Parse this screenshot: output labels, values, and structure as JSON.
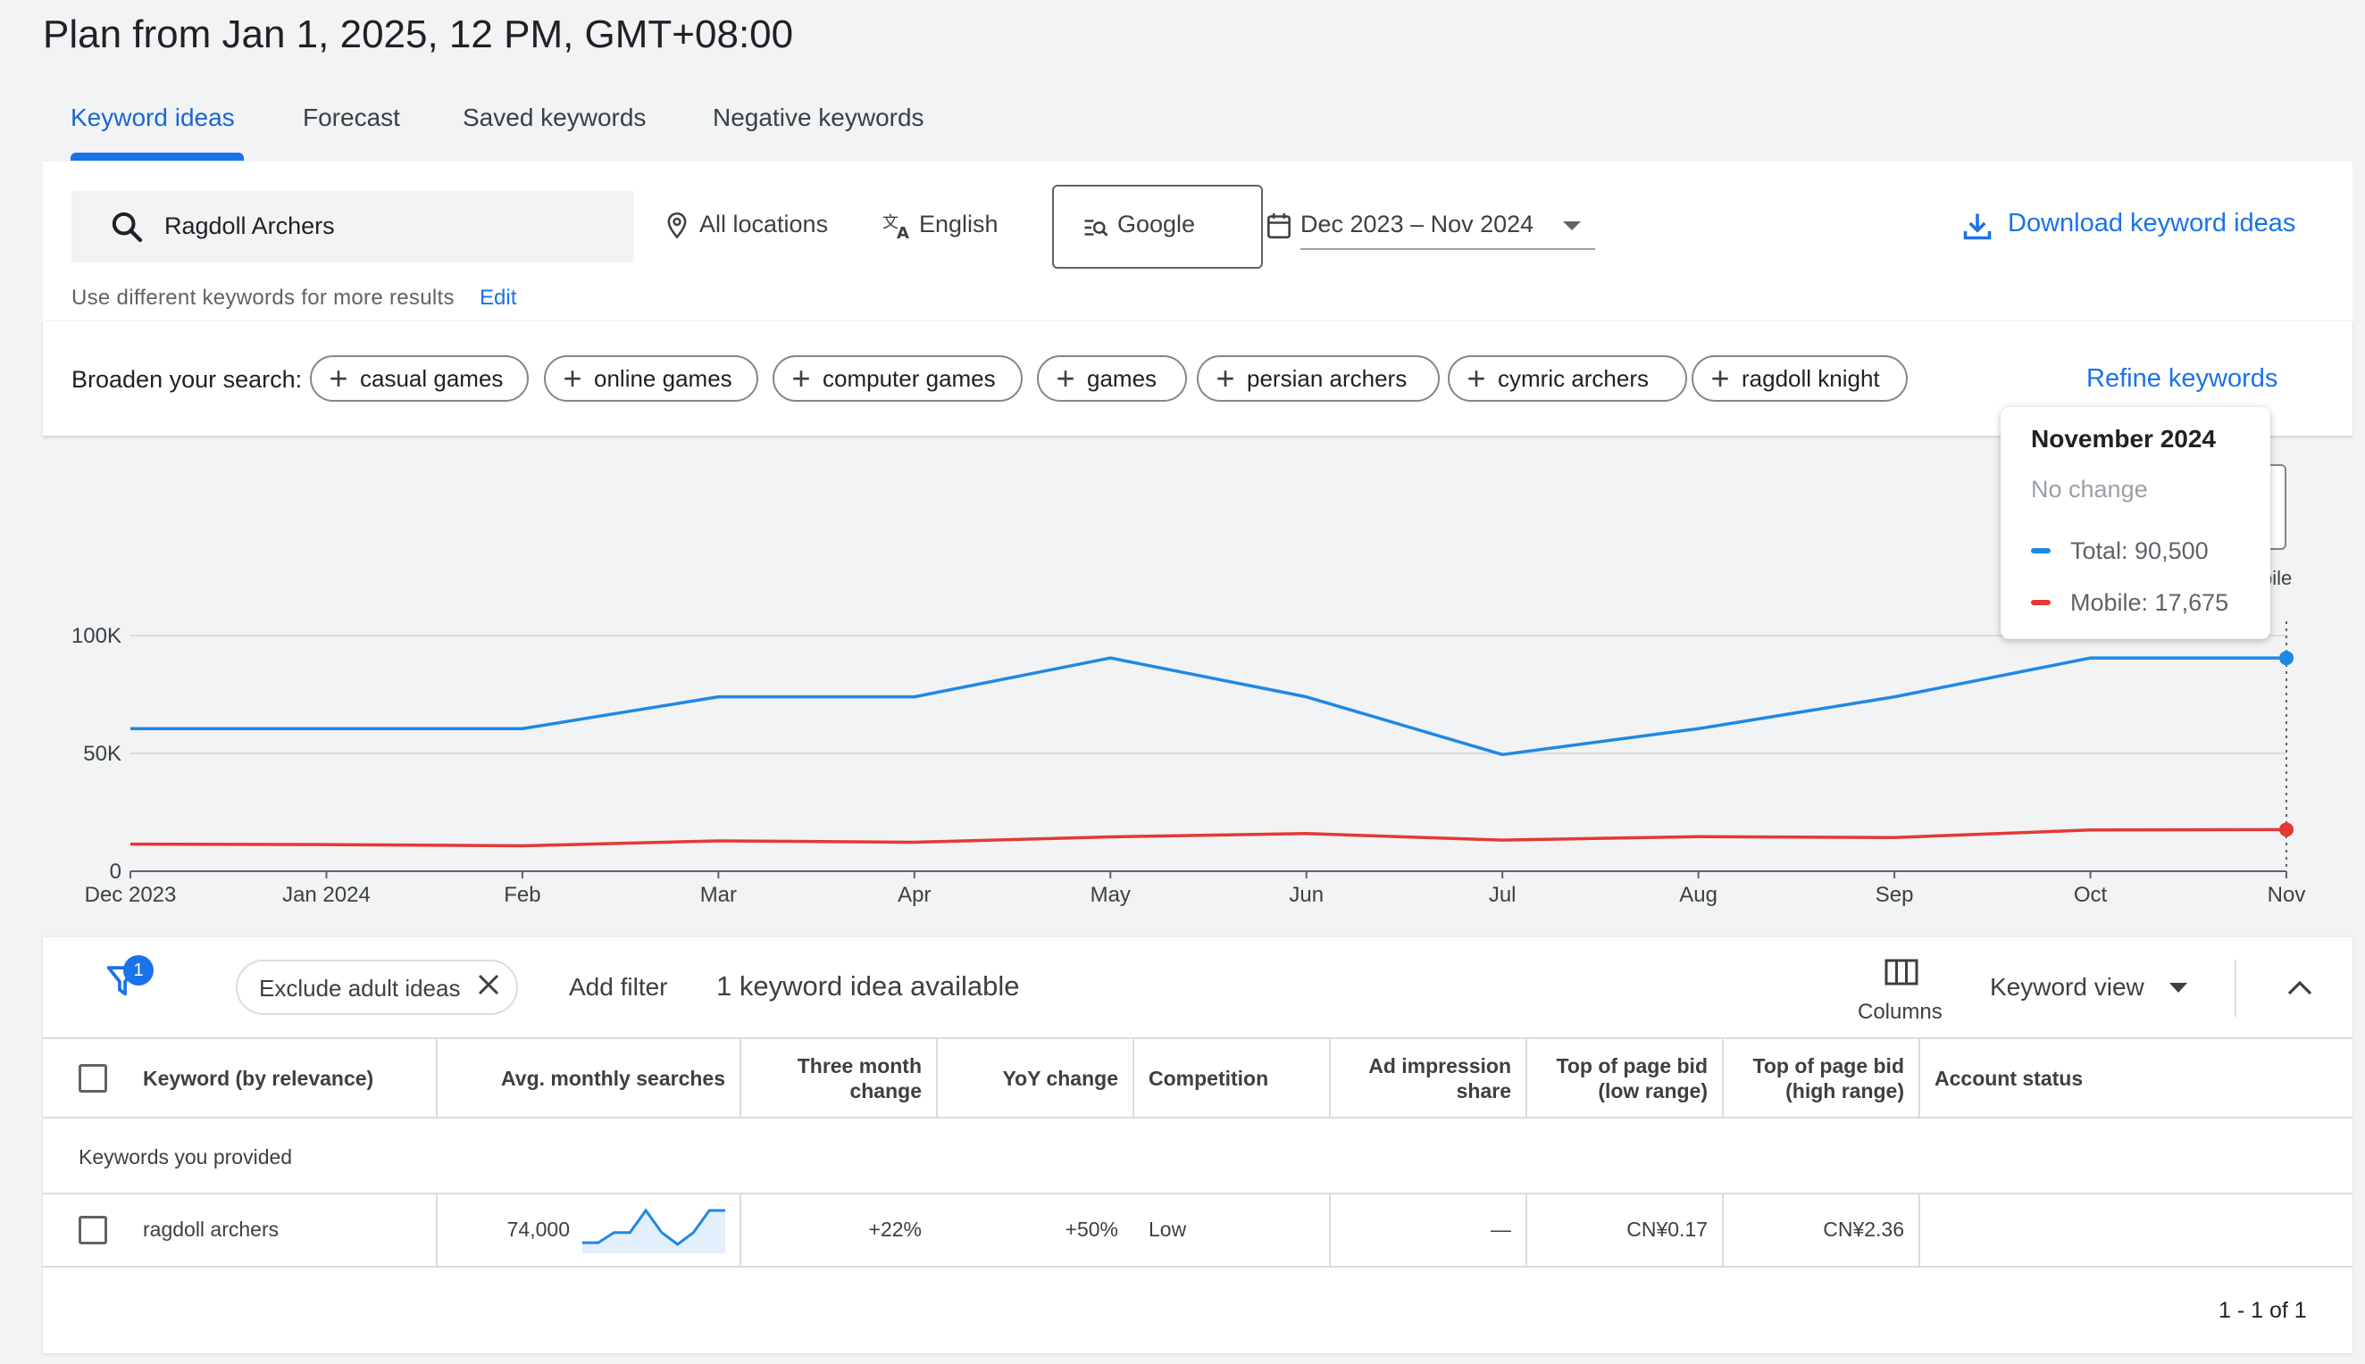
{
  "page": {
    "title": "Plan from Jan 1, 2025, 12 PM, GMT+08:00"
  },
  "tabs": [
    {
      "label": "Keyword ideas",
      "active": true
    },
    {
      "label": "Forecast",
      "active": false
    },
    {
      "label": "Saved keywords",
      "active": false
    },
    {
      "label": "Negative keywords",
      "active": false
    }
  ],
  "search": {
    "value": "Ragdoll Archers",
    "location": "All locations",
    "language": "English",
    "network": "Google",
    "date_range": "Dec 2023 – Nov 2024",
    "download_label": "Download keyword ideas",
    "hint": "Use different keywords for more results",
    "edit_label": "Edit"
  },
  "broaden": {
    "label": "Broaden your search:",
    "chips": [
      "casual games",
      "online games",
      "computer games",
      "games",
      "persian archers",
      "cymric archers",
      "ragdoll knight"
    ],
    "refine_label": "Refine keywords"
  },
  "tooltip": {
    "title": "November 2024",
    "change": "No change",
    "rows": [
      "Total: 90,500",
      "Mobile: 17,675"
    ]
  },
  "legend_fragment": "bile",
  "colors": {
    "accent": "#1a73e8",
    "total_series": "#1e88e5",
    "mobile_series": "#e53935"
  },
  "chart_data": {
    "type": "line",
    "x": [
      "Dec 2023",
      "Jan 2024",
      "Feb",
      "Mar",
      "Apr",
      "May",
      "Jun",
      "Jul",
      "Aug",
      "Sep",
      "Oct",
      "Nov"
    ],
    "series": [
      {
        "name": "Total",
        "values": [
          60500,
          60500,
          60500,
          74000,
          74000,
          90500,
          74000,
          49500,
          60500,
          74000,
          90500,
          90500
        ]
      },
      {
        "name": "Mobile",
        "values": [
          11500,
          11300,
          10800,
          12900,
          12300,
          14600,
          16000,
          13200,
          14700,
          14300,
          17500,
          17675
        ]
      }
    ],
    "yticks": [
      "0",
      "50K",
      "100K"
    ],
    "ylim": [
      0,
      100000
    ],
    "grid": true
  },
  "table_toolbar": {
    "filter_count": "1",
    "exclude_chip": "Exclude adult ideas",
    "add_filter": "Add filter",
    "ideas_count": "1 keyword idea available",
    "columns_label": "Columns",
    "view_label": "Keyword view"
  },
  "table": {
    "headers": {
      "keyword": "Keyword (by relevance)",
      "avg": "Avg. monthly searches",
      "three_month_1": "Three month",
      "three_month_2": "change",
      "yoy": "YoY change",
      "competition": "Competition",
      "ad_share_1": "Ad impression",
      "ad_share_2": "share",
      "low_1": "Top of page bid",
      "low_2": "(low range)",
      "high_1": "Top of page bid",
      "high_2": "(high range)",
      "status": "Account status"
    },
    "group_label": "Keywords you provided",
    "rows": [
      {
        "keyword": "ragdoll archers",
        "avg": "74,000",
        "three_month": "+22%",
        "yoy": "+50%",
        "competition": "Low",
        "ad_share": "—",
        "low_bid": "CN¥0.17",
        "high_bid": "CN¥2.36",
        "status": "",
        "trend": [
          0.05,
          0.05,
          0.35,
          0.35,
          1.0,
          0.35,
          0.0,
          0.35,
          1.0,
          1.0
        ]
      }
    ],
    "pagination": "1 - 1 of 1"
  }
}
